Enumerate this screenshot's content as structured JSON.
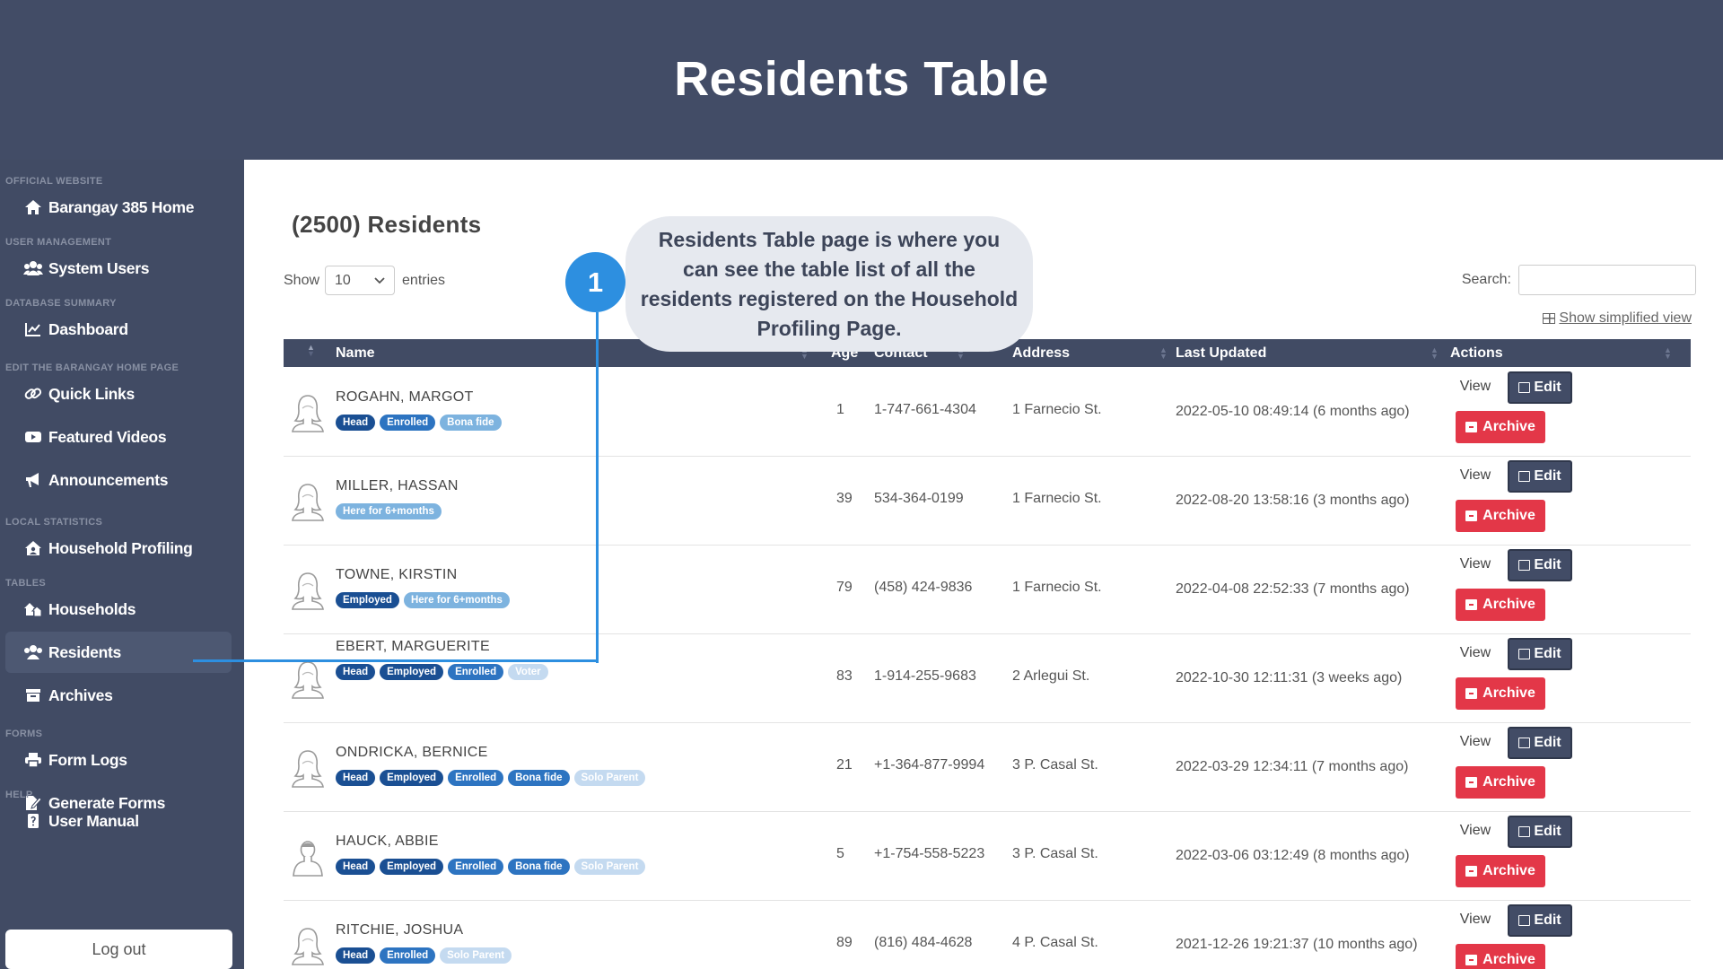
{
  "header": {
    "title": "Residents Table"
  },
  "sidebar": {
    "sections": [
      {
        "label": "OFFICIAL WEBSITE",
        "items": [
          {
            "label": "Barangay 385 Home",
            "icon": "home-icon"
          }
        ]
      },
      {
        "label": "USER MANAGEMENT",
        "items": [
          {
            "label": "System Users",
            "icon": "users-icon"
          }
        ]
      },
      {
        "label": "DATABASE SUMMARY",
        "items": [
          {
            "label": "Dashboard",
            "icon": "chart-line-icon"
          }
        ]
      },
      {
        "label": "EDIT THE BARANGAY HOME PAGE",
        "items": [
          {
            "label": "Quick Links",
            "icon": "link-icon"
          },
          {
            "label": "Featured Videos",
            "icon": "video-icon"
          },
          {
            "label": "Announcements",
            "icon": "megaphone-icon"
          }
        ]
      },
      {
        "label": "LOCAL STATISTICS",
        "items": [
          {
            "label": "Household Profiling",
            "icon": "house-user-icon"
          }
        ]
      },
      {
        "label": "TABLES",
        "items": [
          {
            "label": "Households",
            "icon": "houses-icon"
          },
          {
            "label": "Residents",
            "icon": "residents-icon"
          },
          {
            "label": "Archives",
            "icon": "archive-icon"
          }
        ]
      },
      {
        "label": "FORMS",
        "items": [
          {
            "label": "Form Logs",
            "icon": "printer-icon"
          },
          {
            "label": "Generate Forms",
            "icon": "file-signature-icon"
          }
        ]
      },
      {
        "label": "HELP",
        "items": [
          {
            "label": "User Manual",
            "icon": "book-icon"
          }
        ]
      }
    ],
    "active_item": "Residents",
    "logout_label": "Log out"
  },
  "main": {
    "count_title": "(2500) Residents",
    "show_label": "Show",
    "entries_value": "10",
    "entries_label": "entries",
    "search_label": "Search:",
    "search_value": "",
    "simplified_label": "Show simplified view",
    "columns": [
      "Name",
      "Age",
      "Contact",
      "Address",
      "Last Updated",
      "Actions"
    ],
    "actions": {
      "view": "View",
      "edit": "Edit",
      "archive": "Archive"
    },
    "rows": [
      {
        "name": "ROGAHN, MARGOT",
        "badges": [
          [
            "Head",
            "dark"
          ],
          [
            "Enrolled",
            "blue"
          ],
          [
            "Bona fide",
            "light"
          ]
        ],
        "age": "1",
        "contact": "1-747-661-4304",
        "address": "1 Farnecio St.",
        "updated": "2022-05-10 08:49:14 (6 months ago)",
        "avatar": "female"
      },
      {
        "name": "MILLER, HASSAN",
        "badges": [
          [
            "Here for 6+months",
            "light"
          ]
        ],
        "age": "39",
        "contact": "534-364-0199",
        "address": "1 Farnecio St.",
        "updated": "2022-08-20 13:58:16 (3 months ago)",
        "avatar": "female"
      },
      {
        "name": "TOWNE, KIRSTIN",
        "badges": [
          [
            "Employed",
            "dark"
          ],
          [
            "Here for 6+months",
            "light"
          ]
        ],
        "age": "79",
        "contact": "(458) 424-9836",
        "address": "1 Farnecio St.",
        "updated": "2022-04-08 22:52:33 (7 months ago)",
        "avatar": "female"
      },
      {
        "name": "EBERT, MARGUERITE",
        "badges": [
          [
            "Head",
            "dark"
          ],
          [
            "Employed",
            "dark"
          ],
          [
            "Enrolled",
            "blue"
          ],
          [
            "Voter",
            "faint"
          ]
        ],
        "age": "83",
        "contact": "1-914-255-9683",
        "address": "2 Arlegui St.",
        "updated": "2022-10-30 12:11:31 (3 weeks ago)",
        "avatar": "female"
      },
      {
        "name": "ONDRICKA, BERNICE",
        "badges": [
          [
            "Head",
            "dark"
          ],
          [
            "Employed",
            "dark"
          ],
          [
            "Enrolled",
            "blue"
          ],
          [
            "Bona fide",
            "blue"
          ],
          [
            "Solo Parent",
            "faint"
          ]
        ],
        "age": "21",
        "contact": "+1-364-877-9994",
        "address": "3 P. Casal St.",
        "updated": "2022-03-29 12:34:11 (7 months ago)",
        "avatar": "female"
      },
      {
        "name": "HAUCK, ABBIE",
        "badges": [
          [
            "Head",
            "dark"
          ],
          [
            "Employed",
            "dark"
          ],
          [
            "Enrolled",
            "blue"
          ],
          [
            "Bona fide",
            "blue"
          ],
          [
            "Solo Parent",
            "faint"
          ]
        ],
        "age": "5",
        "contact": "+1-754-558-5223",
        "address": "3 P. Casal St.",
        "updated": "2022-03-06 03:12:49 (8 months ago)",
        "avatar": "male"
      },
      {
        "name": "RITCHIE, JOSHUA",
        "badges": [
          [
            "Head",
            "dark"
          ],
          [
            "Enrolled",
            "blue"
          ],
          [
            "Solo Parent",
            "faint"
          ]
        ],
        "age": "89",
        "contact": "(816) 484-4628",
        "address": "4 P. Casal St.",
        "updated": "2021-12-26 19:21:37 (10 months ago)",
        "avatar": "female"
      }
    ]
  },
  "callout": {
    "number": "1",
    "text": "Residents Table page is where you can see the table list of all the residents registered on the Household Profiling Page."
  },
  "colors": {
    "sidebar": "#414b64",
    "header": "#424c66",
    "accent": "#2d8fe0",
    "archive": "#e33748"
  }
}
